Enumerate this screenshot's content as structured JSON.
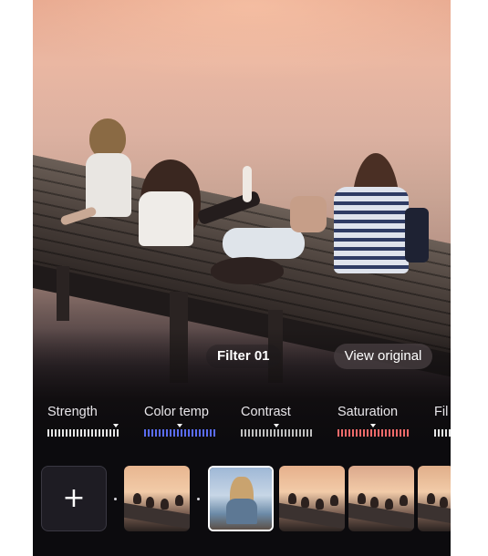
{
  "overlay": {
    "filter_name": "Filter 01",
    "view_original_label": "View original"
  },
  "adjustments": [
    {
      "label": "Strength",
      "color": "#e6e6e6"
    },
    {
      "label": "Color temp",
      "color": "#5a6cf2"
    },
    {
      "label": "Contrast",
      "color": "#bfbfbf"
    },
    {
      "label": "Saturation",
      "color": "#f06a6a"
    },
    {
      "label": "Fil",
      "color": "#e6e6e6"
    }
  ],
  "filters": {
    "add_label": "+",
    "thumbnails": [
      {
        "name": "warm-1",
        "tone": "#e8b690",
        "selected": false
      },
      {
        "name": "original",
        "tone": "#b9cbe2",
        "selected": true
      },
      {
        "name": "warm-2",
        "tone": "#e6b08c",
        "selected": false
      },
      {
        "name": "warm-3",
        "tone": "#dba88c",
        "selected": false
      },
      {
        "name": "warm-4",
        "tone": "#e0ae8a",
        "selected": false
      }
    ]
  }
}
